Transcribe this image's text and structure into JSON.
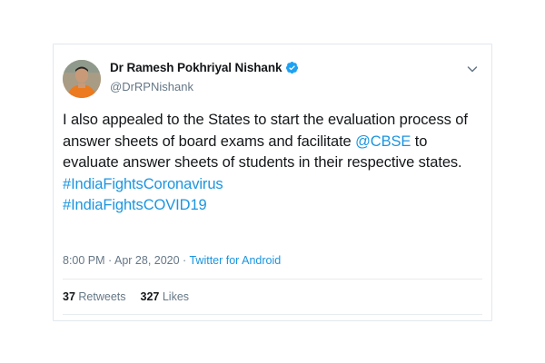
{
  "author": {
    "display_name": "Dr Ramesh Pokhriyal Nishank",
    "handle": "@DrRPNishank",
    "verified": true
  },
  "tweet": {
    "text_part1": "I also appealed to the States to start the evaluation process of answer sheets of board exams and facilitate ",
    "mention": "@CBSE",
    "text_part2": " to evaluate answer sheets of students in their respective states.",
    "hashtag1": "#IndiaFightsCoronavirus",
    "hashtag2": "#IndiaFightsCOVID19"
  },
  "meta": {
    "time": "8:00 PM",
    "separator1": " · ",
    "date": "Apr 28, 2020",
    "separator2": " · ",
    "source": "Twitter for Android"
  },
  "stats": {
    "retweets_count": "37",
    "retweets_label": "Retweets",
    "likes_count": "327",
    "likes_label": "Likes"
  },
  "colors": {
    "link": "#1b95e0",
    "secondary_text": "#657786",
    "primary_text": "#14171a",
    "verified_badge": "#1da1f2"
  },
  "icons": {
    "verified": "verified-badge-icon",
    "caret": "chevron-down-icon"
  }
}
